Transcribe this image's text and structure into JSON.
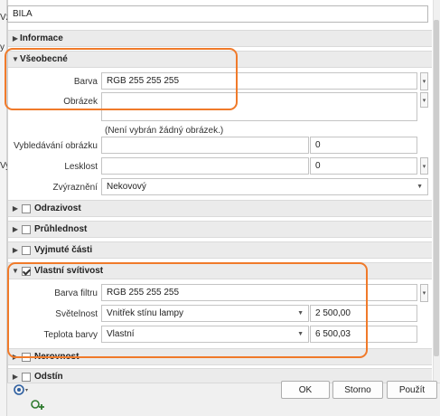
{
  "material_name": "BILA",
  "left_strip": [
    "y",
    "Vz",
    "Vy"
  ],
  "categories": {
    "informace": "Informace",
    "vseobecne": "Všeobecné",
    "odrazivost": "Odrazivost",
    "pruhlednost": "Průhlednost",
    "vyjmute": "Vyjmuté části",
    "vlastni": "Vlastní svítivost",
    "nerovnost": "Nerovnost",
    "odstin": "Odstín"
  },
  "general": {
    "barva_label": "Barva",
    "barva_value": "RGB 255 255 255",
    "obrazek_label": "Obrázek",
    "obrazek_note": "(Není vybrán žádný obrázek.)",
    "vyblebavani_label": "Vybledávání obrázku",
    "vyblebavani_value": "0",
    "lesklost_label": "Lesklost",
    "lesklost_value": "0",
    "zvyrazneni_label": "Zvýraznění",
    "zvyrazneni_value": "Nekovový"
  },
  "self_illum": {
    "barva_filtru_label": "Barva filtru",
    "barva_filtru_value": "RGB 255 255 255",
    "svetelnost_label": "Světelnost",
    "svetelnost_select": "Vnitřek stínu lampy",
    "svetelnost_value": "2 500,00",
    "teplota_label": "Teplota barvy",
    "teplota_select": "Vlastní",
    "teplota_value": "6 500,03"
  },
  "buttons": {
    "ok": "OK",
    "storno": "Storno",
    "pouzit": "Použít"
  },
  "colors": {
    "highlight": "#f07a2a",
    "category_bg": "#ebebeb"
  },
  "icons": [
    "collapsed-arrow-icon",
    "expanded-arrow-icon",
    "checkbox-icon",
    "chevron-down-icon",
    "material-tool-icon"
  ]
}
